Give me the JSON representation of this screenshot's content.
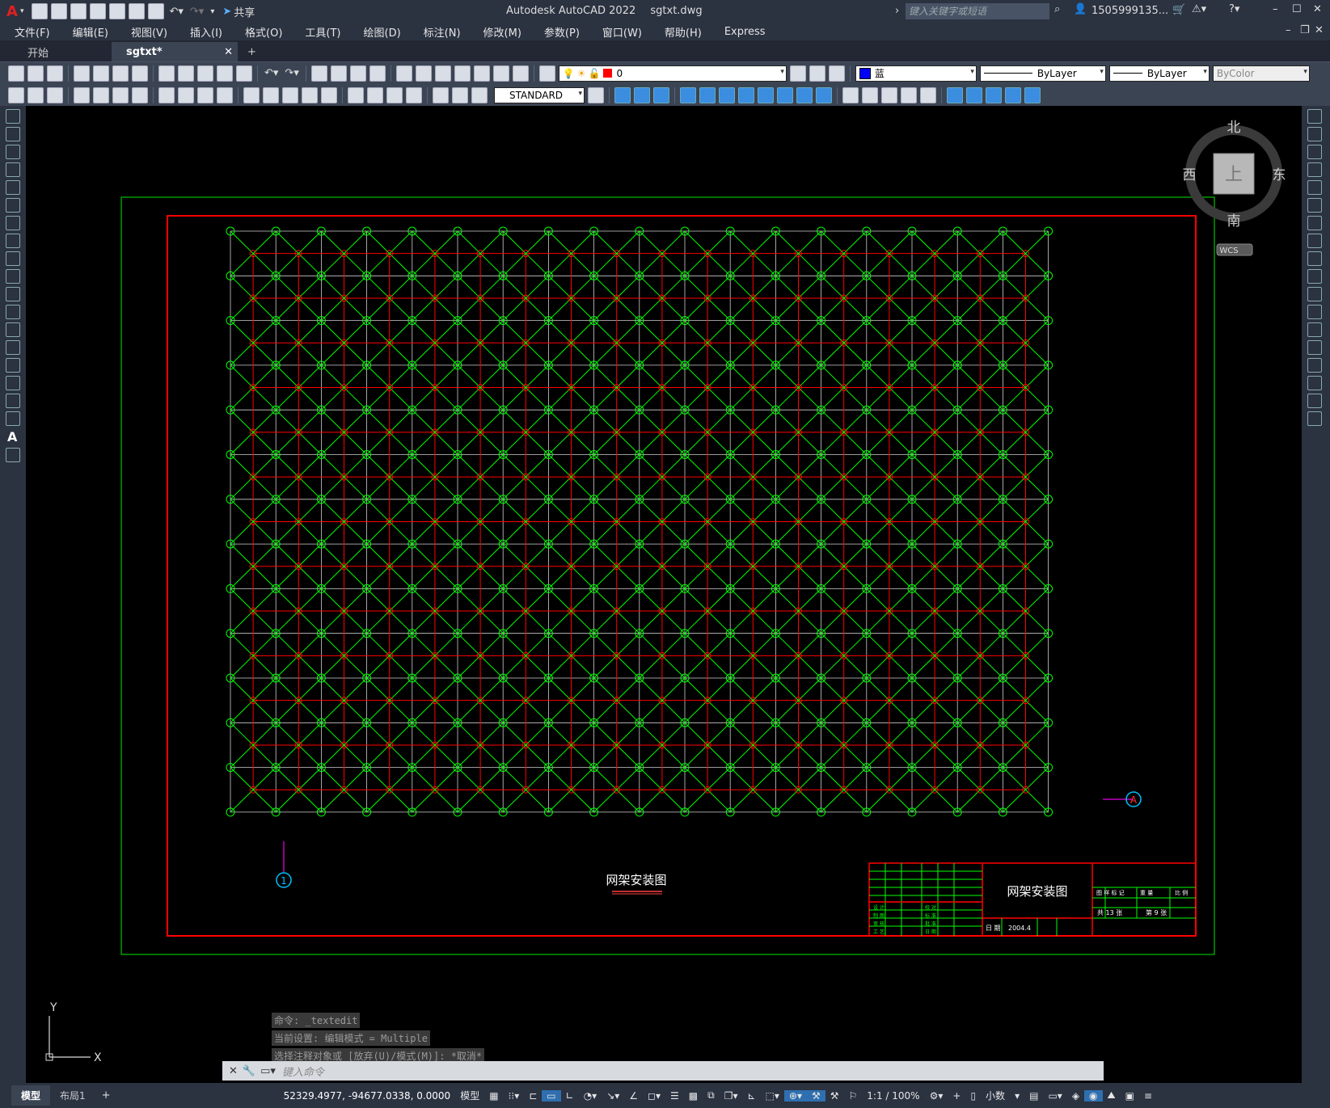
{
  "title": {
    "app": "Autodesk AutoCAD 2022",
    "file": "sgtxt.dwg",
    "share": "共享",
    "search_placeholder": "键入关键字或短语",
    "user": "1505999135..."
  },
  "menus": [
    "文件(F)",
    "编辑(E)",
    "视图(V)",
    "插入(I)",
    "格式(O)",
    "工具(T)",
    "绘图(D)",
    "标注(N)",
    "修改(M)",
    "参数(P)",
    "窗口(W)",
    "帮助(H)",
    "Express"
  ],
  "tabs": [
    {
      "label": "开始",
      "active": false
    },
    {
      "label": "sgtxt*",
      "active": true
    }
  ],
  "layer": {
    "name": "0",
    "color": "#ff0000"
  },
  "props": {
    "color_name": "蓝",
    "color_hex": "#0000ff",
    "linetype": "ByLayer",
    "lineweight": "ByLayer",
    "plotstyle": "ByColor"
  },
  "textstyle": "STANDARD",
  "viewcube": {
    "north": "北",
    "south": "南",
    "east": "东",
    "west": "西",
    "face": "上",
    "ucs": "WCS"
  },
  "ucs_icon": {
    "x": "X",
    "y": "Y"
  },
  "drawing": {
    "frame_outer": "#00c000",
    "frame_inner": "#ff0000",
    "grid_color": "#00ff00",
    "chord_color": "#ff0000",
    "caption": "网架安装图",
    "titleblock": {
      "title": "网架安装图",
      "date_label": "日 期",
      "date": "2004.4",
      "sheet_total": "共 13 张",
      "sheet_no": "第 9 张",
      "header_cells": [
        "图 样 标 记",
        "重 量",
        "比 例"
      ],
      "sign_rows": [
        "设 计",
        "制 图",
        "审 核",
        "工 艺"
      ],
      "sign_rows2": [
        "校 对",
        "标 准",
        "批 准",
        "日 期"
      ]
    },
    "axis_labels": [
      "A",
      "1"
    ]
  },
  "command": {
    "history": [
      "命令: _textedit",
      "当前设置: 编辑模式 = Multiple",
      "选择注释对象或 [放弃(U)/模式(M)]: *取消*"
    ],
    "placeholder": "键入命令"
  },
  "status": {
    "layout_tabs": [
      "模型",
      "布局1"
    ],
    "coords": "52329.4977, -94677.0338, 0.0000",
    "space": "模型",
    "scale": "1:1 / 100%",
    "units": "小数"
  }
}
